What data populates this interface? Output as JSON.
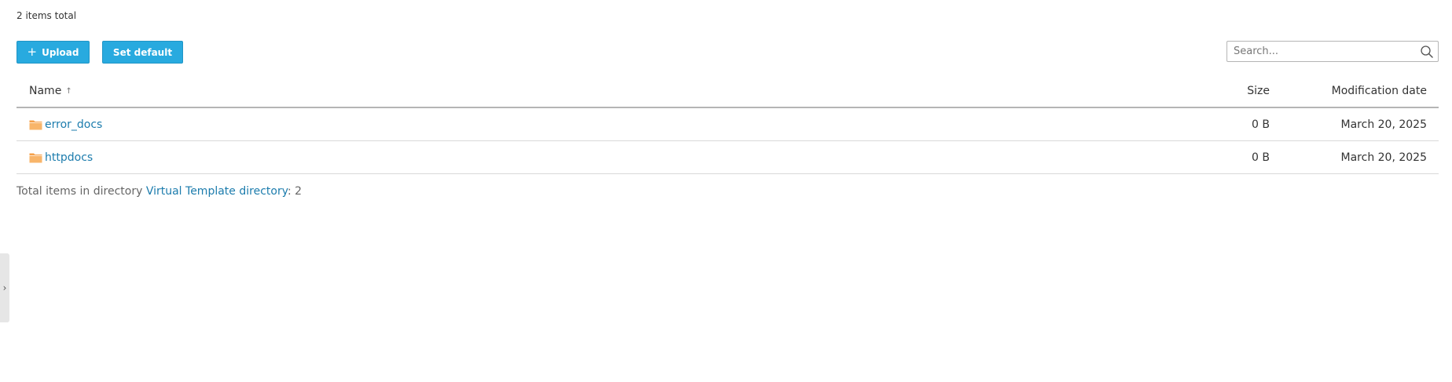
{
  "summary": {
    "items_total": "2 items total"
  },
  "toolbar": {
    "upload_label": "Upload",
    "set_default_label": "Set default"
  },
  "search": {
    "placeholder": "Search..."
  },
  "table": {
    "columns": {
      "name": "Name",
      "size": "Size",
      "modification_date": "Modification date"
    },
    "sort_indicator": "↑",
    "rows": [
      {
        "name": "error_docs",
        "size": "0 B",
        "date": "March 20, 2025",
        "icon": "folder-icon"
      },
      {
        "name": "httpdocs",
        "size": "0 B",
        "date": "March 20, 2025",
        "icon": "folder-icon"
      }
    ]
  },
  "footer": {
    "prefix": "Total items in directory ",
    "directory_link": "Virtual Template directory",
    "count": ": 2"
  },
  "side_toggle": {
    "glyph": "›"
  },
  "colors": {
    "button_bg": "#28aadf",
    "link": "#1c7cad",
    "folder": "#f5a04a"
  }
}
